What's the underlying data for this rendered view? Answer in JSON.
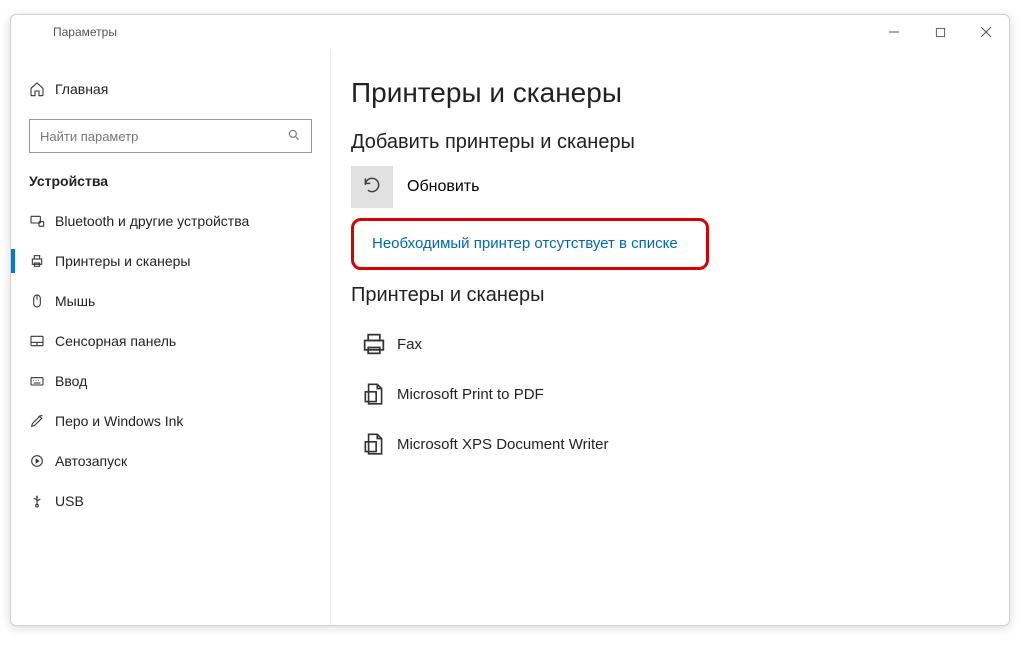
{
  "window": {
    "title": "Параметры"
  },
  "sidebar": {
    "home": "Главная",
    "search_placeholder": "Найти параметр",
    "category": "Устройства",
    "items": [
      {
        "label": "Bluetooth и другие устройства",
        "icon": "bluetooth"
      },
      {
        "label": "Принтеры и сканеры",
        "icon": "printer",
        "active": true
      },
      {
        "label": "Мышь",
        "icon": "mouse"
      },
      {
        "label": "Сенсорная панель",
        "icon": "touchpad"
      },
      {
        "label": "Ввод",
        "icon": "keyboard"
      },
      {
        "label": "Перо и Windows Ink",
        "icon": "pen"
      },
      {
        "label": "Автозапуск",
        "icon": "autoplay"
      },
      {
        "label": "USB",
        "icon": "usb"
      }
    ]
  },
  "content": {
    "page_title": "Принтеры и сканеры",
    "add_section": "Добавить принтеры и сканеры",
    "refresh_label": "Обновить",
    "missing_link": "Необходимый принтер отсутствует в списке",
    "list_section": "Принтеры и сканеры",
    "devices": [
      {
        "label": "Fax",
        "icon": "fax"
      },
      {
        "label": "Microsoft Print to PDF",
        "icon": "doc"
      },
      {
        "label": "Microsoft XPS Document Writer",
        "icon": "doc"
      }
    ]
  }
}
